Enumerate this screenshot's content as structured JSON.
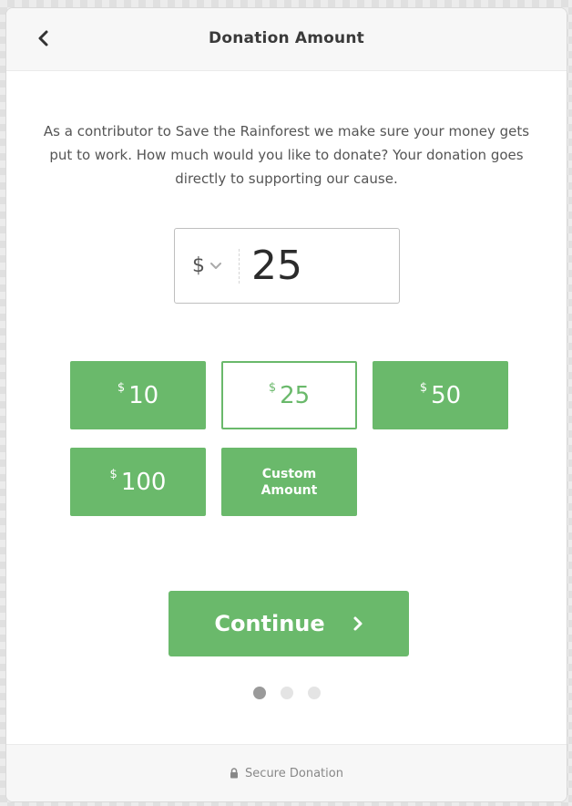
{
  "header": {
    "title": "Donation Amount",
    "back_icon": "chevron-left-icon"
  },
  "description": "As a contributor to Save the Rainforest we make sure your money gets put to work. How much would you like to donate? Your donation goes directly to supporting our cause.",
  "amount": {
    "currency_symbol": "$",
    "currency_icon": "chevron-down-icon",
    "value": "25"
  },
  "options": [
    {
      "currency": "$",
      "value": "10",
      "selected": false
    },
    {
      "currency": "$",
      "value": "25",
      "selected": true
    },
    {
      "currency": "$",
      "value": "50",
      "selected": false
    },
    {
      "currency": "$",
      "value": "100",
      "selected": false
    }
  ],
  "custom_label_line1": "Custom",
  "custom_label_line2": "Amount",
  "continue": {
    "label": "Continue",
    "icon": "chevron-right-icon"
  },
  "pagination": {
    "total": 3,
    "current": 1
  },
  "footer": {
    "icon": "lock-icon",
    "label": "Secure Donation"
  },
  "colors": {
    "accent": "#6ab96b",
    "text": "#3a3a3a",
    "muted": "#888888"
  }
}
